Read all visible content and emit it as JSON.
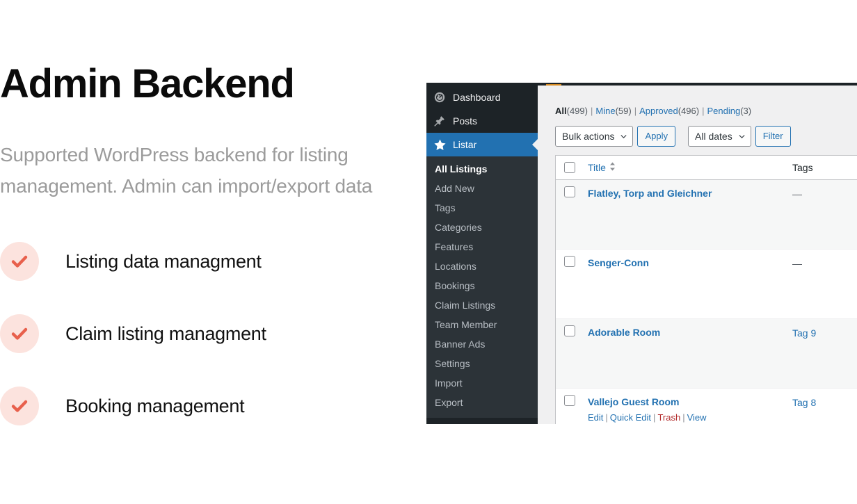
{
  "hero": {
    "title": "Admin Backend",
    "subtitle": "Supported WordPress backend for listing management. Admin can import/export data",
    "features": [
      {
        "label": "Listing data managment",
        "icon": "check-icon"
      },
      {
        "label": "Claim listing managment",
        "icon": "check-icon"
      },
      {
        "label": "Booking management",
        "icon": "check-icon"
      }
    ],
    "colors": {
      "badge_bg": "#fce3de",
      "check": "#e8604c",
      "title": "#0b0b0b",
      "subtitle": "#9b9b9b"
    }
  },
  "wp": {
    "colors": {
      "sidebar_bg": "#1d2327",
      "submenu_bg": "#2c3338",
      "current_bg": "#2271b1",
      "link": "#2271b1",
      "trash": "#b32d2e",
      "content_bg": "#f0f0f1"
    },
    "sidebar": {
      "items": [
        {
          "label": "Dashboard",
          "icon": "dashboard-gauge-icon",
          "current": false
        },
        {
          "label": "Posts",
          "icon": "pin-icon",
          "current": false
        },
        {
          "label": "Listar",
          "icon": "star-icon",
          "current": true
        }
      ],
      "submenu": [
        {
          "label": "All Listings",
          "current": true
        },
        {
          "label": "Add New",
          "current": false
        },
        {
          "label": "Tags",
          "current": false
        },
        {
          "label": "Categories",
          "current": false
        },
        {
          "label": "Features",
          "current": false
        },
        {
          "label": "Locations",
          "current": false
        },
        {
          "label": "Bookings",
          "current": false
        },
        {
          "label": "Claim Listings",
          "current": false
        },
        {
          "label": "Team Member",
          "current": false
        },
        {
          "label": "Banner Ads",
          "current": false
        },
        {
          "label": "Settings",
          "current": false
        },
        {
          "label": "Import",
          "current": false
        },
        {
          "label": "Export",
          "current": false
        }
      ]
    },
    "status_links": [
      {
        "label": "All",
        "count": "(499)",
        "current": true
      },
      {
        "label": "Mine",
        "count": "(59)",
        "current": false
      },
      {
        "label": "Approved",
        "count": "(496)",
        "current": false
      },
      {
        "label": "Pending",
        "count": "(3)",
        "current": false
      }
    ],
    "toolbar": {
      "bulk_actions_value": "Bulk actions",
      "apply_label": "Apply",
      "dates_value": "All dates",
      "filter_label": "Filter"
    },
    "table": {
      "columns": {
        "title": "Title",
        "tags": "Tags"
      },
      "rows": [
        {
          "title": "Flatley, Torp and Gleichner",
          "tags": "—",
          "tags_is_dash": true,
          "alt": true,
          "actions": []
        },
        {
          "title": "Senger-Conn",
          "tags": "—",
          "tags_is_dash": true,
          "alt": false,
          "actions": []
        },
        {
          "title": "Adorable Room",
          "tags": "Tag 9",
          "tags_is_dash": false,
          "alt": true,
          "actions": []
        },
        {
          "title": "Vallejo Guest Room",
          "tags": "Tag 8",
          "tags_is_dash": false,
          "alt": false,
          "actions": [
            {
              "label": "Edit",
              "kind": "edit"
            },
            {
              "label": "Quick Edit",
              "kind": "quick-edit"
            },
            {
              "label": "Trash",
              "kind": "trash"
            },
            {
              "label": "View",
              "kind": "view"
            }
          ]
        }
      ]
    }
  }
}
